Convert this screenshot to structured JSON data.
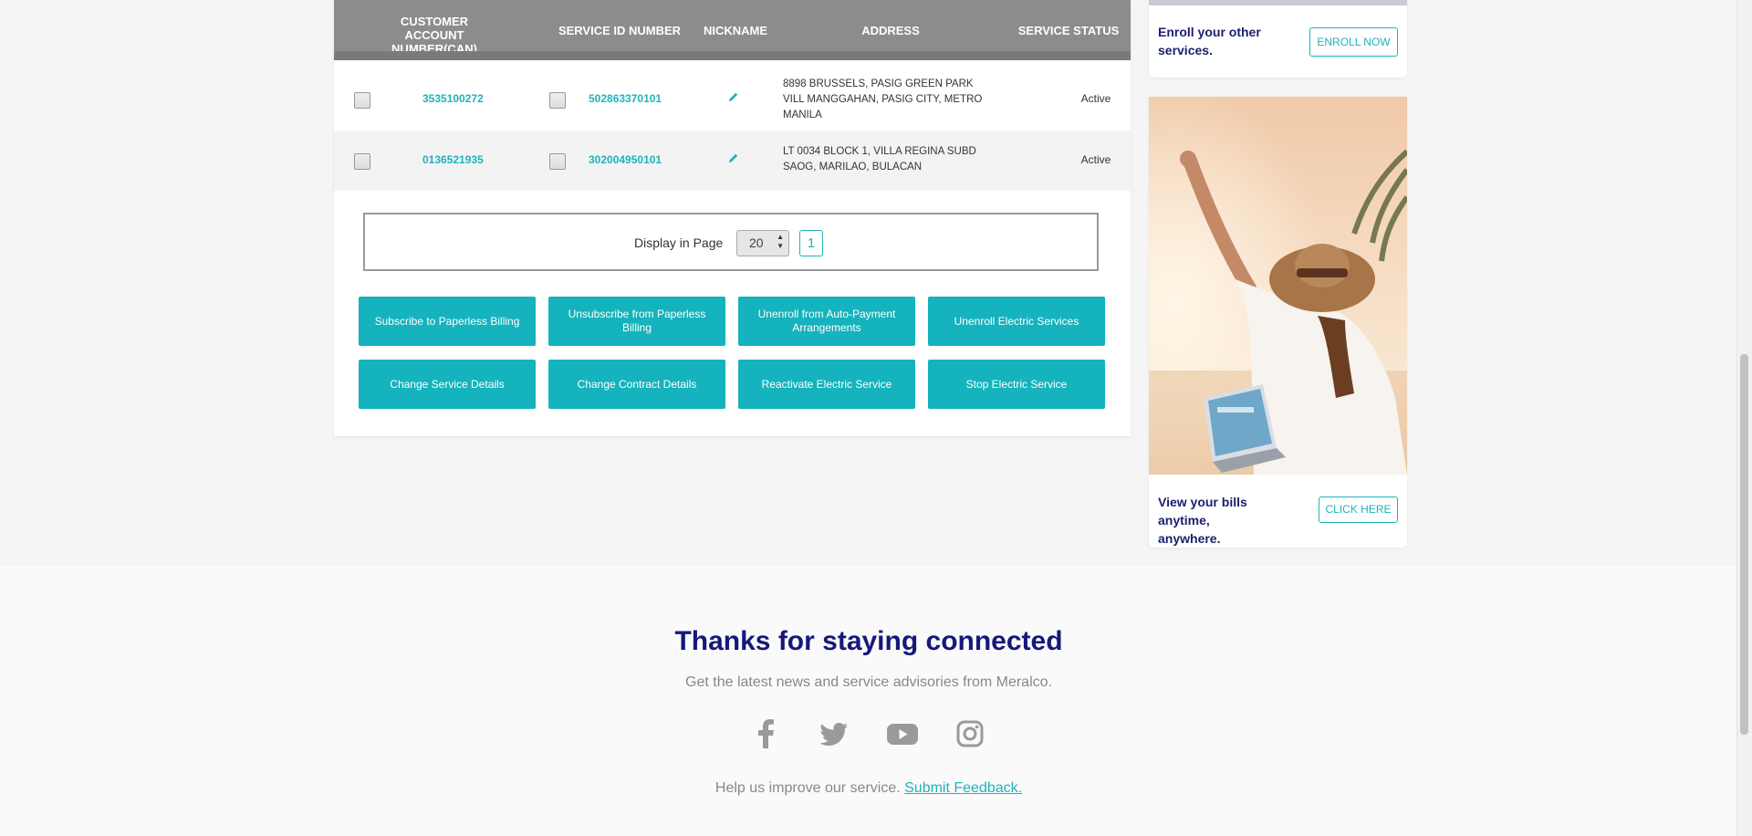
{
  "table": {
    "headers": {
      "can": "CUSTOMER ACCOUNT NUMBER(CAN)",
      "sin": "SERVICE ID NUMBER",
      "nickname": "NICKNAME",
      "address": "ADDRESS",
      "status": "SERVICE STATUS"
    },
    "rows": [
      {
        "can": "3535100272",
        "sin": "502863370101",
        "address": "8898 BRUSSELS, PASIG GREEN PARK VILL MANGGAHAN, PASIG CITY, METRO MANILA",
        "status": "Active"
      },
      {
        "can": "0136521935",
        "sin": "302004950101",
        "address": "LT 0034 BLOCK 1, VILLA REGINA SUBD SAOG, MARILAO, BULACAN",
        "status": "Active"
      }
    ]
  },
  "pager": {
    "label": "Display in Page",
    "page_size": "20",
    "current_page": "1"
  },
  "actions": [
    "Subscribe to Paperless Billing",
    "Unsubscribe from Paperless Billing",
    "Unenroll from Auto-Payment Arrangements",
    "Unenroll Electric Services",
    "Change Service Details",
    "Change Contract Details",
    "Reactivate Electric Service",
    "Stop Electric Service"
  ],
  "sidebar": {
    "enroll": {
      "text": "Enroll your other services.",
      "button": "ENROLL NOW"
    },
    "bills": {
      "text": "View your bills anytime, anywhere.",
      "button": "CLICK HERE"
    }
  },
  "footer": {
    "title": "Thanks for staying connected",
    "subtitle": "Get the latest news and service advisories from Meralco.",
    "help_text": "Help us improve our service.",
    "feedback_link": "Submit Feedback.",
    "social_icons": [
      "facebook-icon",
      "twitter-icon",
      "youtube-icon",
      "instagram-icon"
    ]
  },
  "colors": {
    "accent": "#14b3bd",
    "navy": "#16187a",
    "header_gray": "#8c8c8c"
  }
}
